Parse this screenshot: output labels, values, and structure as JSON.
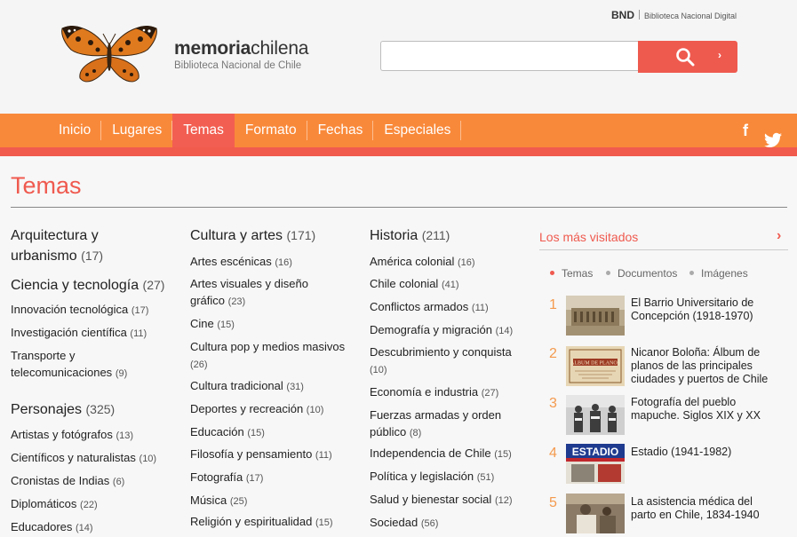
{
  "header": {
    "bnd_code": "BND",
    "bnd_full": "Biblioteca Nacional Digital",
    "brand_light": "memoria",
    "brand_bold": "chilena",
    "brand_subtitle": "Biblioteca Nacional de Chile",
    "search_placeholder": ""
  },
  "nav": {
    "items": [
      "Inicio",
      "Lugares",
      "Temas",
      "Formato",
      "Fechas",
      "Especiales"
    ],
    "active": "Temas"
  },
  "page_title": "Temas",
  "columns": {
    "col1": [
      {
        "type": "cat",
        "label": "Arquitectura y urbanismo",
        "count": "(17)"
      },
      {
        "type": "cat",
        "label": "Ciencia y tecnología",
        "count": "(27)"
      },
      {
        "type": "sub",
        "label": "Innovación tecnológica",
        "count": "(17)"
      },
      {
        "type": "sub",
        "label": "Investigación científica",
        "count": "(11)"
      },
      {
        "type": "sub",
        "label": "Transporte y telecomunicaciones",
        "count": "(9)"
      },
      {
        "type": "cat",
        "label": "Personajes",
        "count": "(325)"
      },
      {
        "type": "sub",
        "label": "Artistas y fotógrafos",
        "count": "(13)"
      },
      {
        "type": "sub",
        "label": "Científicos y naturalistas",
        "count": "(10)"
      },
      {
        "type": "sub",
        "label": "Cronistas de Indias",
        "count": "(6)"
      },
      {
        "type": "sub",
        "label": "Diplomáticos",
        "count": "(22)"
      },
      {
        "type": "sub",
        "label": "Educadores",
        "count": "(14)"
      }
    ],
    "col2": [
      {
        "type": "cat",
        "label": "Cultura y artes",
        "count": "(171)"
      },
      {
        "type": "sub",
        "label": "Artes escénicas",
        "count": "(16)"
      },
      {
        "type": "sub",
        "label": "Artes visuales y diseño gráfico",
        "count": "(23)"
      },
      {
        "type": "sub",
        "label": "Cine",
        "count": "(15)"
      },
      {
        "type": "sub",
        "label": "Cultura pop y medios masivos",
        "count": "(26)"
      },
      {
        "type": "sub",
        "label": "Cultura tradicional",
        "count": "(31)"
      },
      {
        "type": "sub",
        "label": "Deportes y recreación",
        "count": "(10)"
      },
      {
        "type": "sub",
        "label": "Educación",
        "count": "(15)"
      },
      {
        "type": "sub",
        "label": "Filosofía y pensamiento",
        "count": "(11)"
      },
      {
        "type": "sub",
        "label": "Fotografía",
        "count": "(17)"
      },
      {
        "type": "sub",
        "label": "Música",
        "count": "(25)"
      },
      {
        "type": "sub",
        "label": "Religión y espiritualidad",
        "count": "(15)"
      }
    ],
    "col3": [
      {
        "type": "cat",
        "label": "Historia",
        "count": "(211)"
      },
      {
        "type": "sub",
        "label": "América colonial",
        "count": "(16)"
      },
      {
        "type": "sub",
        "label": "Chile colonial",
        "count": "(41)"
      },
      {
        "type": "sub",
        "label": "Conflictos armados",
        "count": "(11)"
      },
      {
        "type": "sub",
        "label": "Demografía y migración",
        "count": "(14)"
      },
      {
        "type": "sub",
        "label": "Descubrimiento y conquista",
        "count": "(10)"
      },
      {
        "type": "sub",
        "label": "Economía e industria",
        "count": "(27)"
      },
      {
        "type": "sub",
        "label": "Fuerzas armadas y orden público",
        "count": "(8)"
      },
      {
        "type": "sub",
        "label": "Independencia de Chile",
        "count": "(15)"
      },
      {
        "type": "sub",
        "label": "Política y legislación",
        "count": "(51)"
      },
      {
        "type": "sub",
        "label": "Salud y bienestar social",
        "count": "(12)"
      },
      {
        "type": "sub",
        "label": "Sociedad",
        "count": "(56)"
      }
    ]
  },
  "most_visited": {
    "title": "Los más visitados",
    "tabs": [
      "Temas",
      "Documentos",
      "Imágenes"
    ],
    "active_tab": "Temas",
    "items": [
      {
        "rank": "1",
        "text": "El Barrio Universitario de Concepción (1918-1970)"
      },
      {
        "rank": "2",
        "text": "Nicanor Boloña: Álbum de planos de las principales ciudades y puertos de Chile"
      },
      {
        "rank": "3",
        "text": "Fotografía del pueblo mapuche. Siglos XIX y XX"
      },
      {
        "rank": "4",
        "text": "Estadio (1941-1982)"
      },
      {
        "rank": "5",
        "text": "La asistencia médica del parto en Chile, 1834-1940"
      }
    ],
    "thumb2_caption": "ALBUM DE PLANOS",
    "thumb4_caption": "ESTADIO"
  },
  "colors": {
    "accent": "#ef5a4f",
    "nav_orange": "#f9893a",
    "rank_orange": "#f49a4e"
  }
}
